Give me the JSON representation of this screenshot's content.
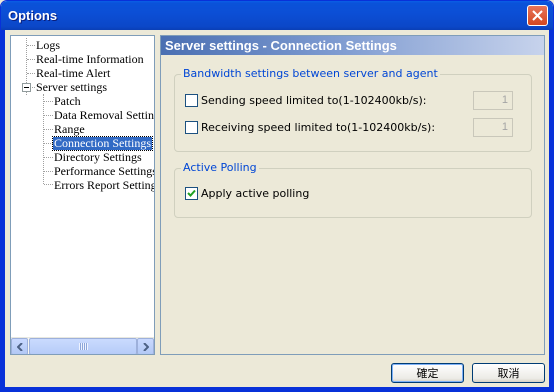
{
  "window": {
    "title": "Options"
  },
  "tree": {
    "items": [
      {
        "label": "Logs"
      },
      {
        "label": "Real-time Information"
      },
      {
        "label": "Real-time Alert"
      },
      {
        "label": "Server settings"
      },
      {
        "label": "Patch"
      },
      {
        "label": "Data Removal Settings"
      },
      {
        "label": "Range"
      },
      {
        "label": "Connection Settings"
      },
      {
        "label": "Directory Settings"
      },
      {
        "label": "Performance Settings"
      },
      {
        "label": "Errors Report Settings"
      }
    ]
  },
  "panel": {
    "header": "Server settings - Connection Settings",
    "bandwidth_group": {
      "title": "Bandwidth settings between server and agent",
      "sending": {
        "label": "Sending speed limited to(1-102400kb/s):",
        "checked": false,
        "value": "1"
      },
      "receiving": {
        "label": "Receiving speed limited to(1-102400kb/s):",
        "checked": false,
        "value": "1"
      }
    },
    "polling_group": {
      "title": "Active Polling",
      "apply": {
        "label": "Apply active polling",
        "checked": true
      }
    }
  },
  "buttons": {
    "ok": "確定",
    "cancel": "取消"
  },
  "colors": {
    "titlebar": "#0a52d9",
    "selection": "#316ac5",
    "group_title": "#0046d5"
  }
}
